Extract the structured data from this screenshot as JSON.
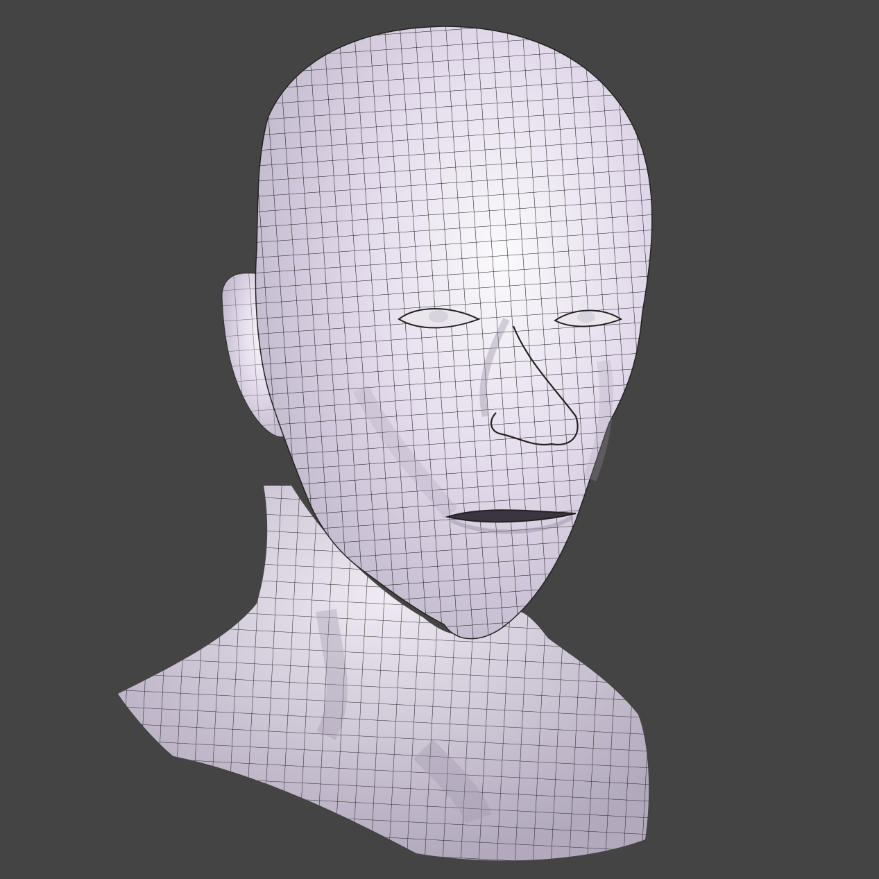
{
  "viewport": {
    "background_color": "#444444"
  },
  "model": {
    "subject": "head-bust",
    "shading": "matcap",
    "wireframe_overlay": true,
    "surface_color_light": "#f4f1f7",
    "surface_color_mid": "#d9d0e6",
    "surface_color_shadow": "#a79fb2",
    "wire_color": "#1a1a1a"
  }
}
